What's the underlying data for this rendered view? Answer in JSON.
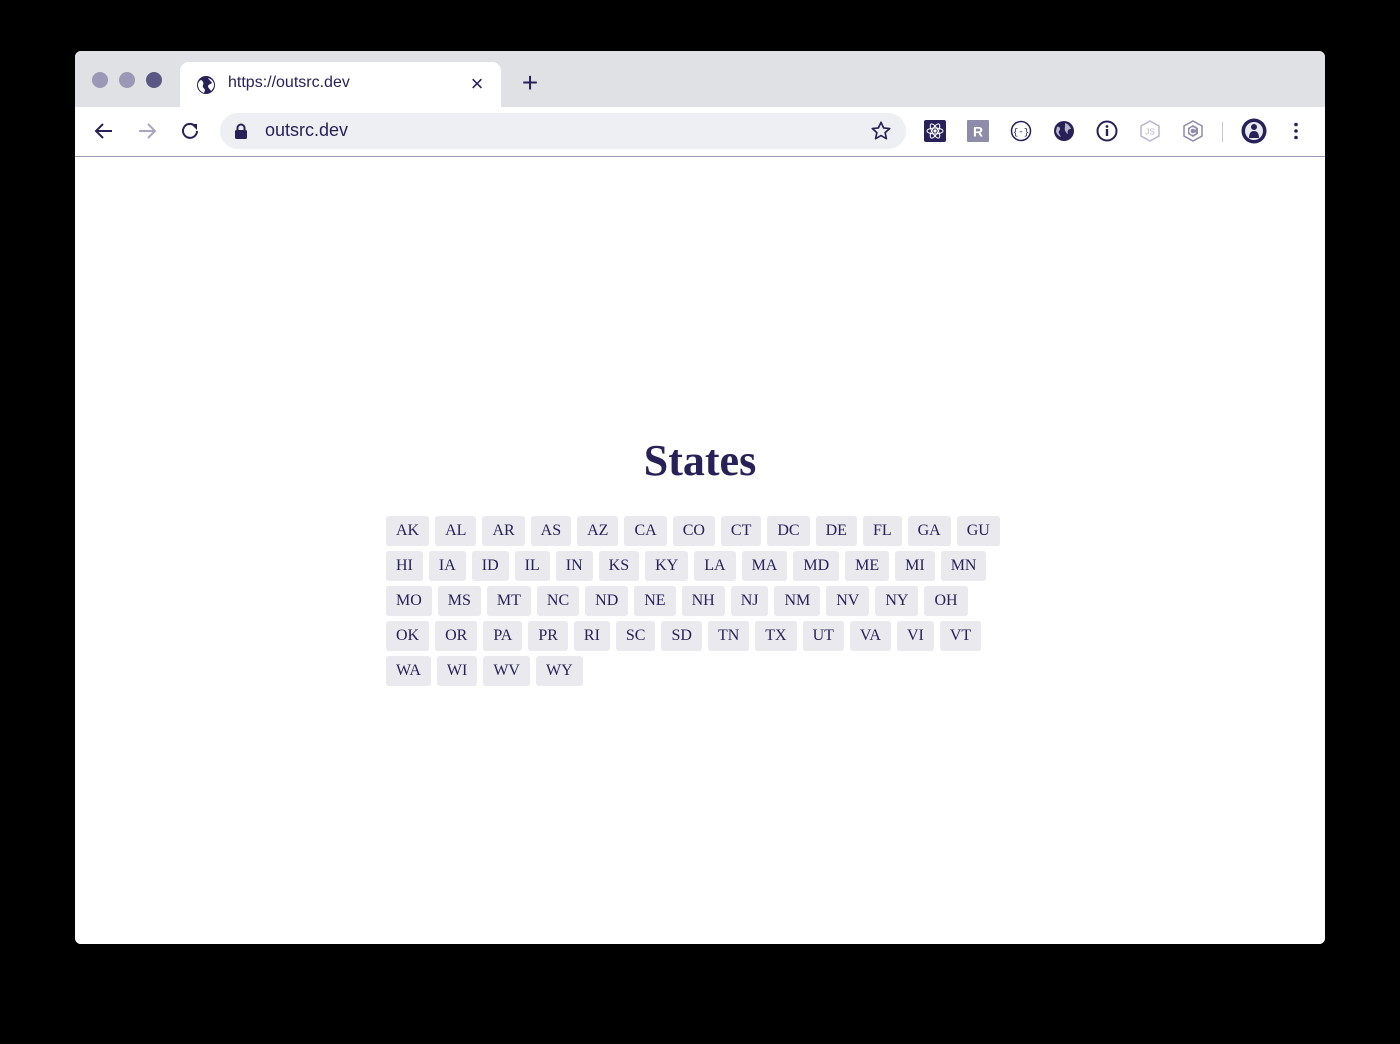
{
  "browser": {
    "tab": {
      "title": "https://outsrc.dev",
      "favicon": "globe-icon",
      "close_icon": "close-icon"
    },
    "new_tab_icon": "plus-icon",
    "toolbar": {
      "url": "outsrc.dev",
      "icons": [
        "back-arrow-icon",
        "forward-arrow-icon",
        "reload-icon",
        "lock-icon",
        "bookmark-star-icon"
      ],
      "extensions": [
        "react-devtools-icon",
        "r-extension-icon",
        "jsonview-icon",
        "globe-extension-icon",
        "info-icon",
        "nodejs-icon",
        "hexagon-extension-icon"
      ],
      "menu_icon": "kebab-menu-icon"
    },
    "colors": {
      "accent": "#272157",
      "tabbar": "#dfe1e5",
      "chip": "#e9e9ee"
    }
  },
  "page": {
    "title": "States",
    "states": [
      "AK",
      "AL",
      "AR",
      "AS",
      "AZ",
      "CA",
      "CO",
      "CT",
      "DC",
      "DE",
      "FL",
      "GA",
      "GU",
      "HI",
      "IA",
      "ID",
      "IL",
      "IN",
      "KS",
      "KY",
      "LA",
      "MA",
      "MD",
      "ME",
      "MI",
      "MN",
      "MO",
      "MS",
      "MT",
      "NC",
      "ND",
      "NE",
      "NH",
      "NJ",
      "NM",
      "NV",
      "NY",
      "OH",
      "OK",
      "OR",
      "PA",
      "PR",
      "RI",
      "SC",
      "SD",
      "TN",
      "TX",
      "UT",
      "VA",
      "VI",
      "VT",
      "WA",
      "WI",
      "WV",
      "WY"
    ]
  }
}
